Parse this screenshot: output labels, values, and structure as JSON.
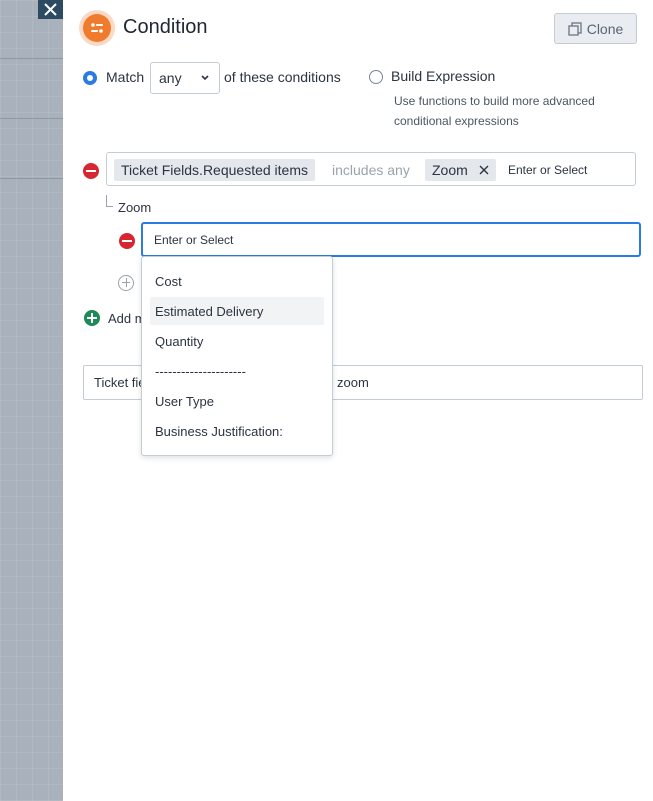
{
  "header": {
    "title": "Condition",
    "clone_label": "Clone",
    "icon": "condition-icon",
    "accent_color": "#f07b2c"
  },
  "close": {
    "icon": "close-icon"
  },
  "match": {
    "match_label": "Match",
    "selected_value": "any",
    "suffix": "of these conditions",
    "build_label": "Build Expression",
    "build_help_line1": "Use functions to build more advanced",
    "build_help_line2": "conditional expressions"
  },
  "condition": {
    "field": "Ticket Fields.Requested items",
    "operator": "includes any",
    "value_tag": "Zoom",
    "placeholder": "Enter or Select"
  },
  "sub_condition": {
    "parent_label": "Zoom",
    "input_value": "Enter or Select"
  },
  "add_label": "Add m",
  "expression": {
    "left_text": "Ticket fie",
    "right_text": "zoom"
  },
  "dropdown": {
    "items": [
      "Cost",
      "Estimated Delivery",
      "Quantity",
      "---------------------",
      "User Type",
      "Business Justification:"
    ],
    "highlighted_index": 1
  },
  "colors": {
    "primary_blue": "#2c7be0",
    "remove_red": "#d7262f",
    "add_green": "#1e8a56"
  }
}
